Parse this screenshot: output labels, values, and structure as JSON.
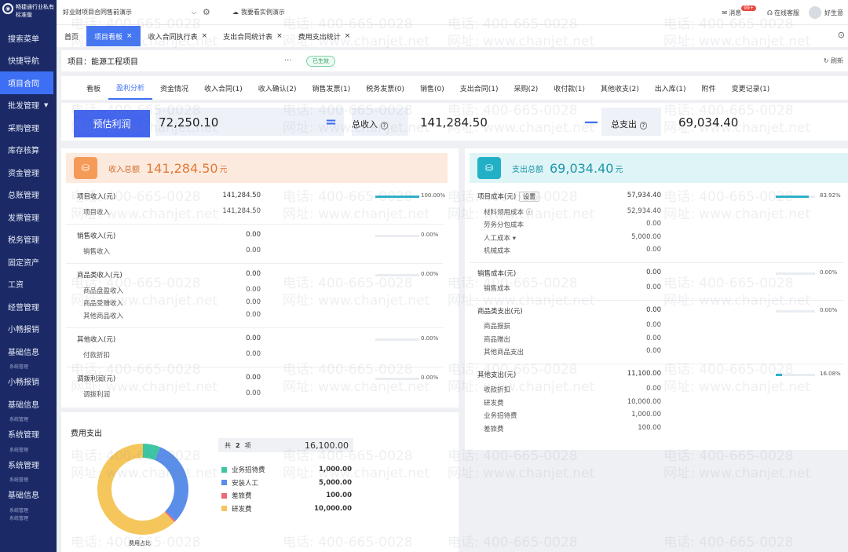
{
  "sidebar": {
    "brand": [
      "畅捷通行业私有",
      "标准版"
    ],
    "items": [
      {
        "label": "搜索菜单",
        "active": false
      },
      {
        "label": "快捷导航",
        "active": false
      },
      {
        "label": "项目合同",
        "active": true
      },
      {
        "label": "批发管理",
        "active": false,
        "caret": "▼"
      },
      {
        "label": "采购管理",
        "active": false
      },
      {
        "label": "库存核算",
        "active": false
      },
      {
        "label": "资金管理",
        "active": false
      },
      {
        "label": "总账管理",
        "active": false
      },
      {
        "label": "发票管理",
        "active": false
      },
      {
        "label": "税务管理",
        "active": false
      },
      {
        "label": "固定资产",
        "active": false
      },
      {
        "label": "工资",
        "active": false
      },
      {
        "label": "经营管理",
        "active": false
      },
      {
        "label": "小畅报销",
        "active": false
      },
      {
        "label": "基础信息",
        "active": false
      },
      {
        "label": "系统管理",
        "active": false,
        "small": true
      },
      {
        "label": "小畅报销",
        "active": false
      },
      {
        "label": "基础信息",
        "active": false
      },
      {
        "label": "系统管理",
        "active": false,
        "small": true
      },
      {
        "label": "系统管理",
        "active": false
      },
      {
        "label": "系统管理",
        "active": false,
        "small": true
      },
      {
        "label": "系统管理",
        "active": false
      },
      {
        "label": "系统管理",
        "active": false,
        "small": true
      },
      {
        "label": "基础信息",
        "active": false
      },
      {
        "label": "系统管理",
        "active": false,
        "small": true
      },
      {
        "label": "系统管理",
        "active": false,
        "small": true
      }
    ]
  },
  "topbar": {
    "project_select": "好业财项目合同售前演示",
    "demo_link": "我要看实例演示",
    "message_label": "消息",
    "message_badge": "99+",
    "service_label": "在线客服",
    "user_label": "好生意"
  },
  "tabs": [
    {
      "label": "首页",
      "closable": false,
      "active": false
    },
    {
      "label": "项目看板",
      "closable": true,
      "active": true
    },
    {
      "label": "收入合同执行表",
      "closable": true,
      "active": false
    },
    {
      "label": "支出合同统计表",
      "closable": true,
      "active": false
    },
    {
      "label": "费用支出统计",
      "closable": true,
      "active": false
    }
  ],
  "project": {
    "title": "项目：能源工程项目",
    "dots": "···",
    "status": "已生效",
    "refresh": "刷新"
  },
  "subtabs": [
    {
      "label": "看板",
      "active": false
    },
    {
      "label": "盈利分析",
      "active": true
    },
    {
      "label": "资金情况",
      "active": false
    },
    {
      "label": "收入合同(1)",
      "active": false
    },
    {
      "label": "收入确认(2)",
      "active": false
    },
    {
      "label": "销售发票(1)",
      "active": false
    },
    {
      "label": "税务发票(0)",
      "active": false
    },
    {
      "label": "销售(0)",
      "active": false
    },
    {
      "label": "支出合同(1)",
      "active": false
    },
    {
      "label": "采购(2)",
      "active": false
    },
    {
      "label": "收付款(1)",
      "active": false
    },
    {
      "label": "其他收支(2)",
      "active": false
    },
    {
      "label": "出入库(1)",
      "active": false
    },
    {
      "label": "附件",
      "active": false
    },
    {
      "label": "变更记录(1)",
      "active": false
    }
  ],
  "summary": {
    "estimate_label": "预估利润",
    "estimate_value": "72,250.10",
    "eq": "=",
    "income_label": "总收入",
    "income_value": "141,284.50",
    "minus": "—",
    "expense_label": "总支出",
    "expense_value": "69,034.40",
    "help": "?"
  },
  "income": {
    "label": "收入总额",
    "value": "141,284.50",
    "currency": "元",
    "groups": [
      {
        "name": "项目收入(元)",
        "amount": "141,284.50",
        "pct": "100.00%",
        "ratio": 1.0,
        "children": [
          {
            "name": "项目收入",
            "amount": "141,284.50"
          }
        ]
      },
      {
        "name": "销售收入(元)",
        "amount": "0.00",
        "pct": "0.00%",
        "ratio": 0,
        "children": [
          {
            "name": "销售收入",
            "amount": "0.00"
          }
        ]
      },
      {
        "name": "商品类收入(元)",
        "amount": "0.00",
        "pct": "0.00%",
        "ratio": 0,
        "children": [
          {
            "name": "商品盘盈收入",
            "amount": "0.00"
          },
          {
            "name": "商品受赠收入",
            "amount": "0.00"
          },
          {
            "name": "其他商品收入",
            "amount": "0.00"
          }
        ]
      },
      {
        "name": "其他收入(元)",
        "amount": "0.00",
        "pct": "0.00%",
        "ratio": 0,
        "children": [
          {
            "name": "付款折扣",
            "amount": "0.00"
          }
        ]
      },
      {
        "name": "调拨利润(元)",
        "amount": "0.00",
        "pct": "0.00%",
        "ratio": 0,
        "children": [
          {
            "name": "调拨利润",
            "amount": "0.00"
          }
        ]
      }
    ]
  },
  "expense": {
    "label": "支出总额",
    "value": "69,034.40",
    "currency": "元",
    "set_label": "设置",
    "groups": [
      {
        "name": "项目成本(元)",
        "amount": "57,934.40",
        "pct": "83.92%",
        "ratio": 0.8392,
        "setting": true,
        "children": [
          {
            "name": "材料领用成本 ⓘ",
            "amount": "52,934.40"
          },
          {
            "name": "劳务分包成本",
            "amount": "0.00"
          },
          {
            "name": "人工成本 ▾",
            "amount": "5,000.00"
          },
          {
            "name": "机械成本",
            "amount": "0.00"
          }
        ]
      },
      {
        "name": "销售成本(元)",
        "amount": "0.00",
        "pct": "0.00%",
        "ratio": 0,
        "children": [
          {
            "name": "销售成本",
            "amount": "0.00"
          }
        ]
      },
      {
        "name": "商品类支出(元)",
        "amount": "0.00",
        "pct": "0.00%",
        "ratio": 0,
        "children": [
          {
            "name": "商品报损",
            "amount": "0.00"
          },
          {
            "name": "商品赠出",
            "amount": "0.00"
          },
          {
            "name": "其他商品支出",
            "amount": "0.00"
          }
        ]
      },
      {
        "name": "其他支出(元)",
        "amount": "11,100.00",
        "pct": "16.08%",
        "ratio": 0.1608,
        "children": [
          {
            "name": "收款折扣",
            "amount": "0.00"
          },
          {
            "name": "研发费",
            "amount": "10,000.00"
          },
          {
            "name": "业务招待费",
            "amount": "1,000.00"
          },
          {
            "name": "差旅费",
            "amount": "100.00"
          }
        ]
      }
    ]
  },
  "fees": {
    "title": "费用支出",
    "total_prefix": "共",
    "count": "2",
    "count_suffix": "项",
    "total": "16,100.00",
    "caption": "费用占比",
    "items": [
      {
        "name": "业务招待费",
        "value": "1,000.00",
        "amount": 1000,
        "color": "#3cc6a3"
      },
      {
        "name": "安装人工",
        "value": "5,000.00",
        "amount": 5000,
        "color": "#5b8ee8"
      },
      {
        "name": "差旅费",
        "value": "100.00",
        "amount": 100,
        "color": "#e96a7b"
      },
      {
        "name": "研发费",
        "value": "10,000.00",
        "amount": 10000,
        "color": "#f5c65c"
      }
    ]
  },
  "watermark": {
    "phone": "电话: 400-665-0028",
    "site": "网址: www.chanjet.net"
  },
  "colors": {
    "primary": "#3d6ff5",
    "sidebar": "#1b2a66",
    "bar": "#2fb1c9"
  }
}
